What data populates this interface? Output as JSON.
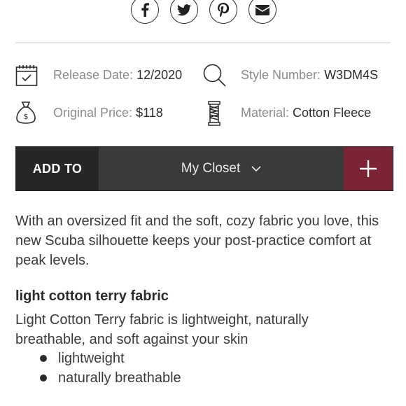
{
  "share": {
    "icons": [
      "facebook-icon",
      "twitter-icon",
      "pinterest-icon",
      "email-icon"
    ]
  },
  "details": {
    "release_label": "Release Date:",
    "release_value": "12/2020",
    "style_label": "Style Number:",
    "style_value": "W3DM4S",
    "price_label": "Original Price:",
    "price_value": "$118",
    "material_label": "Material:",
    "material_value": "Cotton Fleece"
  },
  "add_bar": {
    "add_to_label": "ADD TO",
    "closet_value": "My Closet",
    "plus_symbol": "+",
    "accent_color": "#7d2336"
  },
  "description": "With an oversized fit and the soft, cozy fabric you love, this new Scuba silhouette keeps your post-practice comfort at peak levels.",
  "feature": {
    "title": "light cotton terry fabric",
    "text": "Light Cotton Terry fabric is lightweight, naturally breathable, and soft against your skin",
    "bullets": [
      "lightweight",
      "naturally breathable"
    ]
  }
}
